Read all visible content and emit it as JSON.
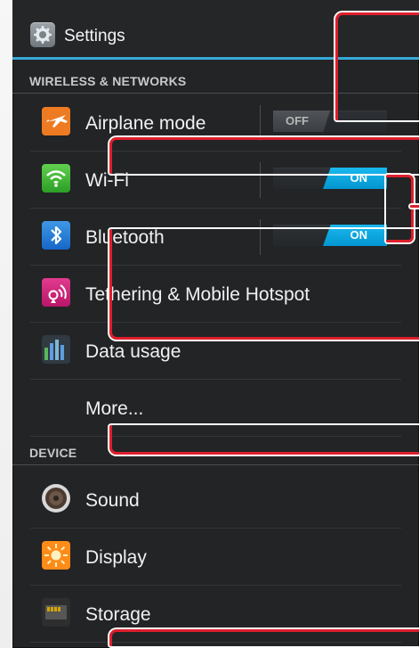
{
  "header": {
    "title": "Settings"
  },
  "sections": {
    "wireless": "WIRELESS & NETWORKS",
    "device": "DEVICE"
  },
  "rows": {
    "airplane": {
      "label": "Airplane mode",
      "state": "OFF"
    },
    "wifi": {
      "label": "Wi-Fi",
      "state": "ON"
    },
    "bluetooth": {
      "label": "Bluetooth",
      "state": "ON"
    },
    "tethering": {
      "label": "Tethering & Mobile Hotspot"
    },
    "data": {
      "label": "Data usage"
    },
    "more": {
      "label": "More..."
    },
    "sound": {
      "label": "Sound"
    },
    "display": {
      "label": "Display"
    },
    "storage": {
      "label": "Storage"
    }
  },
  "colors": {
    "accent": "#35a9d7",
    "callout_red": "#de1f2c",
    "background": "#222426"
  },
  "icons": {
    "settings": "gear-icon",
    "airplane": "airplane-icon",
    "wifi": "wifi-icon",
    "bluetooth": "bluetooth-icon",
    "tethering": "hotspot-icon",
    "data": "data-usage-icon",
    "sound": "speaker-icon",
    "display": "brightness-icon",
    "storage": "sd-card-icon"
  }
}
